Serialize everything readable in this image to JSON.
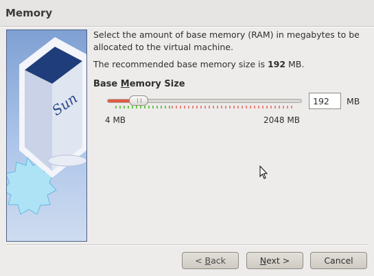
{
  "header": {
    "title": "Memory"
  },
  "content": {
    "description": "Select the amount of base memory (RAM) in megabytes to be allocated to the virtual machine.",
    "recommended_prefix": "The recommended base memory size is ",
    "recommended_value": "192",
    "recommended_suffix": " MB.",
    "section_label_pre": "Base ",
    "section_label_mnemonic": "M",
    "section_label_post": "emory Size"
  },
  "memory_slider": {
    "min_label": "4 MB",
    "max_label": "2048 MB",
    "value": 192,
    "min": 4,
    "max": 2048
  },
  "memory_input": {
    "value": "192",
    "unit": "MB"
  },
  "buttons": {
    "back_prefix": "< ",
    "back_mnemonic": "B",
    "back_rest": "ack",
    "next_mnemonic": "N",
    "next_rest": "ext >",
    "cancel": "Cancel"
  },
  "colors": {
    "slider_fill": "#e25b42",
    "tick_ok": "#6cc24a",
    "tick_high": "#e9827a",
    "art_frame": "#4c5f86"
  },
  "icons": [
    "virtualbox-sun-logo",
    "mouse-pointer-icon"
  ]
}
